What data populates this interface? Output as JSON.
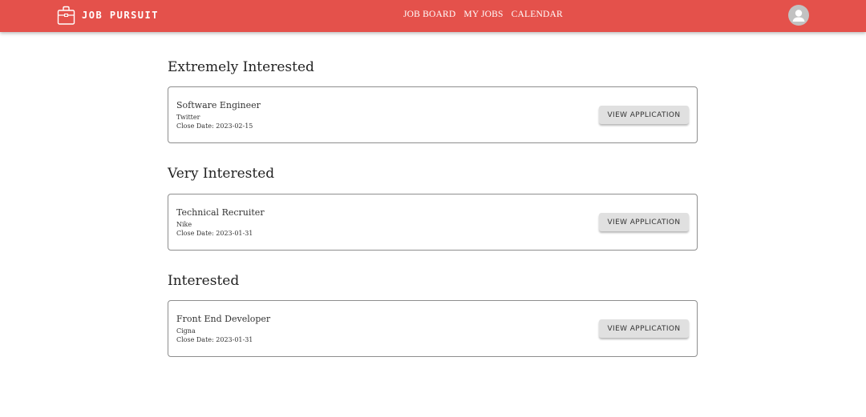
{
  "brand": {
    "name": "JOB PURSUIT",
    "icon": "briefcase-icon"
  },
  "nav": {
    "items": [
      "JOB BOARD",
      "MY JOBS",
      "CALENDAR"
    ]
  },
  "user": {
    "avatar_icon": "user-avatar-icon"
  },
  "colors": {
    "navbar": "#e4514b",
    "button_bg": "#e0e0e0",
    "card_border": "#8e8e8e"
  },
  "sections": [
    {
      "title": "Extremely Interested",
      "jobs": [
        {
          "title": "Software Engineer",
          "company": "Twitter",
          "close_label": "Close Date:",
          "close_date": "2023-02-15",
          "button": "VIEW APPLICATION"
        }
      ]
    },
    {
      "title": "Very Interested",
      "jobs": [
        {
          "title": "Technical Recruiter",
          "company": "Nike",
          "close_label": "Close Date:",
          "close_date": "2023-01-31",
          "button": "VIEW APPLICATION"
        }
      ]
    },
    {
      "title": "Interested",
      "jobs": [
        {
          "title": "Front End Developer",
          "company": "Cigna",
          "close_label": "Close Date:",
          "close_date": "2023-01-31",
          "button": "VIEW APPLICATION"
        }
      ]
    }
  ]
}
